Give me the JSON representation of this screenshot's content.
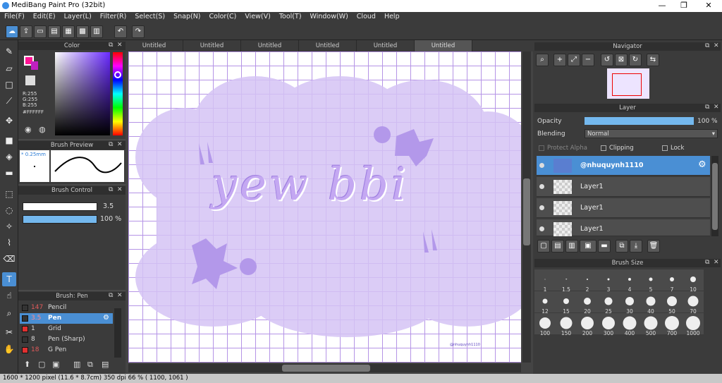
{
  "window": {
    "title": "MediBang Paint Pro (32bit)",
    "minimize": "—",
    "maximize": "❐",
    "close": "✕"
  },
  "menu": [
    "File(F)",
    "Edit(E)",
    "Layer(L)",
    "Filter(R)",
    "Select(S)",
    "Snap(N)",
    "Color(C)",
    "View(V)",
    "Tool(T)",
    "Window(W)",
    "Cloud",
    "Help"
  ],
  "toolbar": {
    "undo": "↶",
    "redo": "↷"
  },
  "color_panel": {
    "title": "Color",
    "rgb_r": "R:255",
    "rgb_g": "G:255",
    "rgb_b": "B:255",
    "hex": "#FFFFFF",
    "primary": "#ff1493",
    "secondary": "#ffffff"
  },
  "brush_preview": {
    "title": "Brush Preview",
    "size": "* 0.25mm"
  },
  "brush_control": {
    "title": "Brush Control",
    "size_value": "3.5",
    "opacity_value": "100 %"
  },
  "brush_list": {
    "title": "Brush: Pen",
    "items": [
      {
        "size": "147",
        "name": "Pencil",
        "color": "#333333"
      },
      {
        "size": "3.5",
        "name": "Pen",
        "color": "#333333"
      },
      {
        "size": "1",
        "name": "Grid",
        "color": "#e03030"
      },
      {
        "size": "8",
        "name": "Pen (Sharp)",
        "color": "#333333"
      },
      {
        "size": "18",
        "name": "G Pen",
        "color": "#e03030"
      }
    ]
  },
  "tabs": [
    "Untitled",
    "Untitled",
    "Untitled",
    "Untitled",
    "Untitled",
    "Untitled"
  ],
  "canvas": {
    "artwork_text": "yew bbi",
    "signature": "@nhuquynh1110",
    "grid_color": "#b594e6",
    "cloud_color": "#d5c4f5"
  },
  "navigator": {
    "title": "Navigator"
  },
  "layer_panel": {
    "title": "Layer",
    "opacity_label": "Opacity",
    "opacity_value": "100 %",
    "opacity_percent": 100,
    "blending_label": "Blending",
    "blending_value": "Normal",
    "protect_alpha": "Protect Alpha",
    "clipping": "Clipping",
    "lock": "Lock",
    "layers": [
      {
        "name": "@nhuquynh1110",
        "selected": true
      },
      {
        "name": "Layer1"
      },
      {
        "name": "Layer1"
      },
      {
        "name": "Layer1"
      }
    ]
  },
  "brush_size": {
    "title": "Brush Size",
    "sizes": [
      "1",
      "1.5",
      "2",
      "3",
      "4",
      "5",
      "7",
      "10",
      "12",
      "15",
      "20",
      "25",
      "30",
      "40",
      "50",
      "70",
      "100",
      "150",
      "200",
      "300",
      "400",
      "500",
      "700",
      "1000"
    ]
  },
  "status": {
    "text": "1600 * 1200 pixel   (11.6 * 8.7cm)  350 dpi  66 %   ( 1100, 1061 )"
  }
}
